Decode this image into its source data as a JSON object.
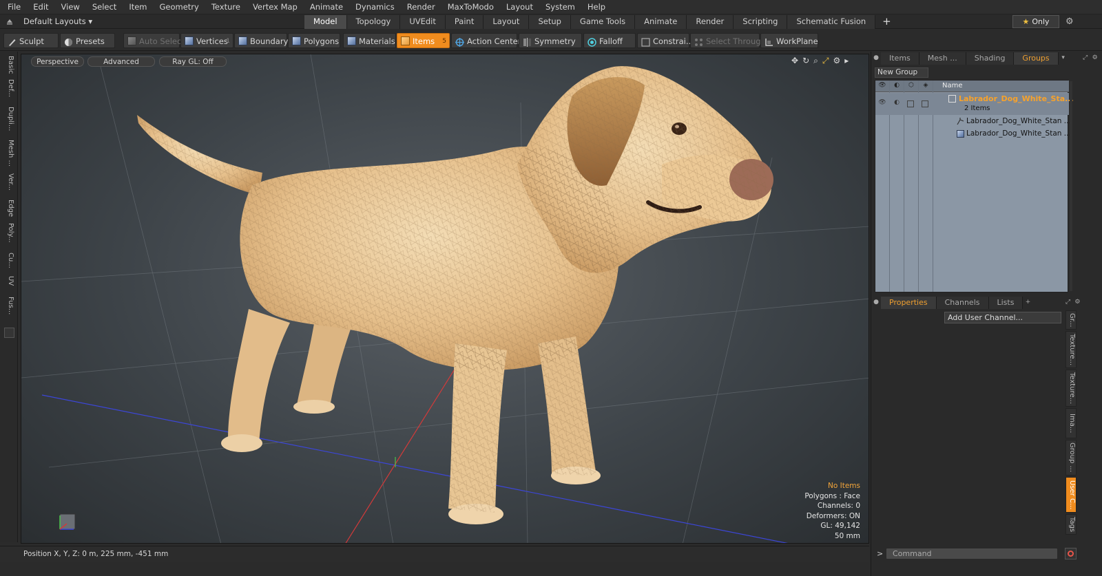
{
  "menubar": [
    "File",
    "Edit",
    "View",
    "Select",
    "Item",
    "Geometry",
    "Texture",
    "Vertex Map",
    "Animate",
    "Dynamics",
    "Render",
    "MaxToModo",
    "Layout",
    "System",
    "Help"
  ],
  "layoutbar": {
    "layout_dropdown": "Default Layouts ▾",
    "tabs": [
      "Model",
      "Topology",
      "UVEdit",
      "Paint",
      "Layout",
      "Setup",
      "Game Tools",
      "Animate",
      "Render",
      "Scripting",
      "Schematic Fusion"
    ],
    "active_tab": "Model",
    "add_tab": "+",
    "only_label": "Only",
    "only_star": "★"
  },
  "toolbar": {
    "sculpt": "Sculpt",
    "presets": "Presets",
    "auto_select": "Auto Select",
    "vertices": "Vertices",
    "vertices_count": "1",
    "boundary": "Boundary",
    "polygons": "Polygons",
    "materials": "Materials",
    "items": "Items",
    "items_count": "5",
    "action_center": "Action Center",
    "symmetry": "Symmetry",
    "falloff": "Falloff",
    "constraints": "Constrai...",
    "select_through": "Select Through",
    "workplane": "WorkPlane"
  },
  "left_strip": [
    "Basic",
    "Def...",
    "Dupli...",
    "Mesh ...",
    "Ver...",
    "Edge",
    "Poly...",
    "Cu...",
    "UV",
    "Fus..."
  ],
  "viewport": {
    "view_mode": "Perspective",
    "advanced": "Advanced",
    "raygl": "Ray GL: Off",
    "stats": {
      "selection": "No Items",
      "polygons": "Polygons : Face",
      "channels": "Channels: 0",
      "deformers": "Deformers: ON",
      "gl": "GL: 49,142",
      "distance": "50 mm"
    }
  },
  "status": {
    "position": "Position X, Y, Z:   0 m, 225 mm, -451 mm"
  },
  "right_panel": {
    "top_tabs": [
      "Items",
      "Mesh ...",
      "Shading",
      "Groups"
    ],
    "active_top_tab": "Groups",
    "new_group": "New Group",
    "list_header_name": "Name",
    "group": {
      "name": "Labrador_Dog_White_Sta...",
      "count": "2 Items"
    },
    "items": [
      "Labrador_Dog_White_Stan ...",
      "Labrador_Dog_White_Stan ..."
    ],
    "bottom_tabs": [
      "Properties",
      "Channels",
      "Lists"
    ],
    "active_bottom_tab": "Properties",
    "add_tab": "+",
    "add_user_channel": "Add User Channel...",
    "side_tabs": [
      "Gr...",
      "Texture...",
      "Texture...",
      "Ima...",
      "Group ...",
      "User C...",
      "Tags"
    ],
    "active_side_tab": "User C...",
    "command_placeholder": "Command"
  },
  "colors": {
    "accent": "#f08c1e",
    "group_name": "#f7a22b",
    "stats_warning": "#f4a63a"
  }
}
